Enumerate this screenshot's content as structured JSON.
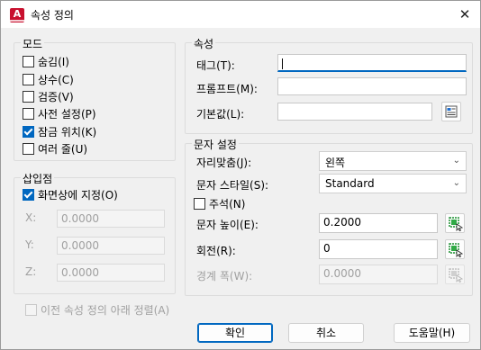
{
  "window": {
    "title": "속성 정의",
    "close_glyph": "✕",
    "icon_text": "A"
  },
  "mode": {
    "legend": "모드",
    "options": [
      {
        "label": "숨김(I)",
        "checked": false
      },
      {
        "label": "상수(C)",
        "checked": false
      },
      {
        "label": "검증(V)",
        "checked": false
      },
      {
        "label": "사전 설정(P)",
        "checked": false
      },
      {
        "label": "잠금 위치(K)",
        "checked": true
      },
      {
        "label": "여러 줄(U)",
        "checked": false
      }
    ]
  },
  "insertion": {
    "legend": "삽입점",
    "on_screen_label": "화면상에 지정(O)",
    "on_screen_checked": true,
    "x_label": "X:",
    "x_value": "0.0000",
    "y_label": "Y:",
    "y_value": "0.0000",
    "z_label": "Z:",
    "z_value": "0.0000"
  },
  "attribute": {
    "legend": "속성",
    "tag_label": "태그(T):",
    "tag_value": "",
    "prompt_label": "프롬프트(M):",
    "prompt_value": "",
    "default_label": "기본값(L):",
    "default_value": ""
  },
  "text": {
    "legend": "문자 설정",
    "justification_label": "자리맞춤(J):",
    "justification_value": "왼쪽",
    "style_label": "문자 스타일(S):",
    "style_value": "Standard",
    "annotative_label": "주석(N)",
    "annotative_checked": false,
    "height_label": "문자 높이(E):",
    "height_value": "0.2000",
    "rotation_label": "회전(R):",
    "rotation_value": "0",
    "boundary_label": "경계 폭(W):",
    "boundary_value": "0.0000"
  },
  "align_below_label": "이전 속성 정의 아래 정렬(A)",
  "buttons": {
    "ok": "확인",
    "cancel": "취소",
    "help": "도움말(H)"
  }
}
